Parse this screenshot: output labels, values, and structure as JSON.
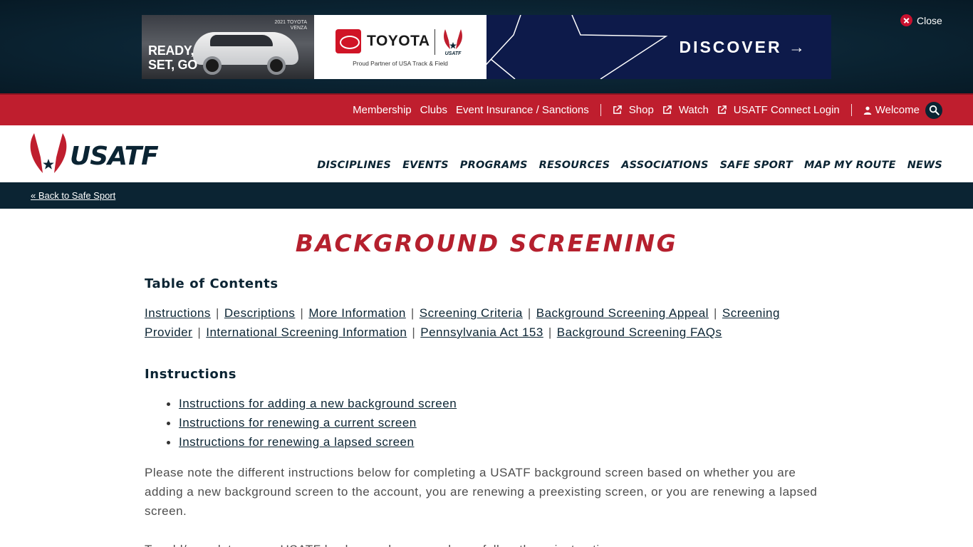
{
  "ad": {
    "car_model": "2021 TOYOTA VENZA",
    "tagline": "READY, SET, GO",
    "brand": "TOYOTA",
    "partner_text": "Proud Partner of USA Track & Field",
    "usatf_mark": "USATF",
    "cta": "DISCOVER →",
    "close_label": "Close"
  },
  "utility_nav": {
    "items": [
      {
        "label": "Membership"
      },
      {
        "label": "Clubs"
      },
      {
        "label": "Event Insurance / Sanctions"
      }
    ],
    "external_items": [
      {
        "label": "Shop",
        "icon": "external-link-icon"
      },
      {
        "label": "Watch",
        "icon": "external-link-icon"
      },
      {
        "label": "USATF Connect Login",
        "icon": "external-link-icon"
      }
    ],
    "welcome_label": "Welcome"
  },
  "header": {
    "logo_text": "USATF",
    "nav": [
      {
        "label": "DISCIPLINES"
      },
      {
        "label": "EVENTS"
      },
      {
        "label": "PROGRAMS"
      },
      {
        "label": "RESOURCES"
      },
      {
        "label": "ASSOCIATIONS"
      },
      {
        "label": "SAFE SPORT"
      },
      {
        "label": "MAP MY ROUTE"
      },
      {
        "label": "NEWS"
      }
    ]
  },
  "breadcrumb": {
    "back_label": "« Back to Safe Sport"
  },
  "page": {
    "title": "BACKGROUND SCREENING",
    "toc_heading": "Table of Contents",
    "toc": [
      {
        "label": "Instructions"
      },
      {
        "label": "Descriptions"
      },
      {
        "label": "More Information"
      },
      {
        "label": "Screening Criteria"
      },
      {
        "label": "Background Screening Appeal"
      },
      {
        "label": "Screening Provider"
      },
      {
        "label": "International Screening Information"
      },
      {
        "label": "Pennsylvania Act 153"
      },
      {
        "label": "Background Screening FAQs"
      }
    ],
    "instructions_heading": "Instructions",
    "instruction_links": [
      {
        "label": "Instructions for adding a new background screen"
      },
      {
        "label": "Instructions for renewing a current screen"
      },
      {
        "label": "Instructions for renewing a lapsed screen"
      }
    ],
    "paragraph": "Please note the different instructions below for completing a USATF background screen based on whether you are adding a new background screen to the account, you are renewing a preexisting screen, or you are renewing a lapsed screen.",
    "paragraph_2": "To add/complete a new USATF background screen, please follow these instructions:"
  },
  "colors": {
    "brand_red": "#bf1e2e",
    "title_red": "#b5202e",
    "navy": "#0b2433",
    "ad_blue": "#0d1a4a"
  }
}
